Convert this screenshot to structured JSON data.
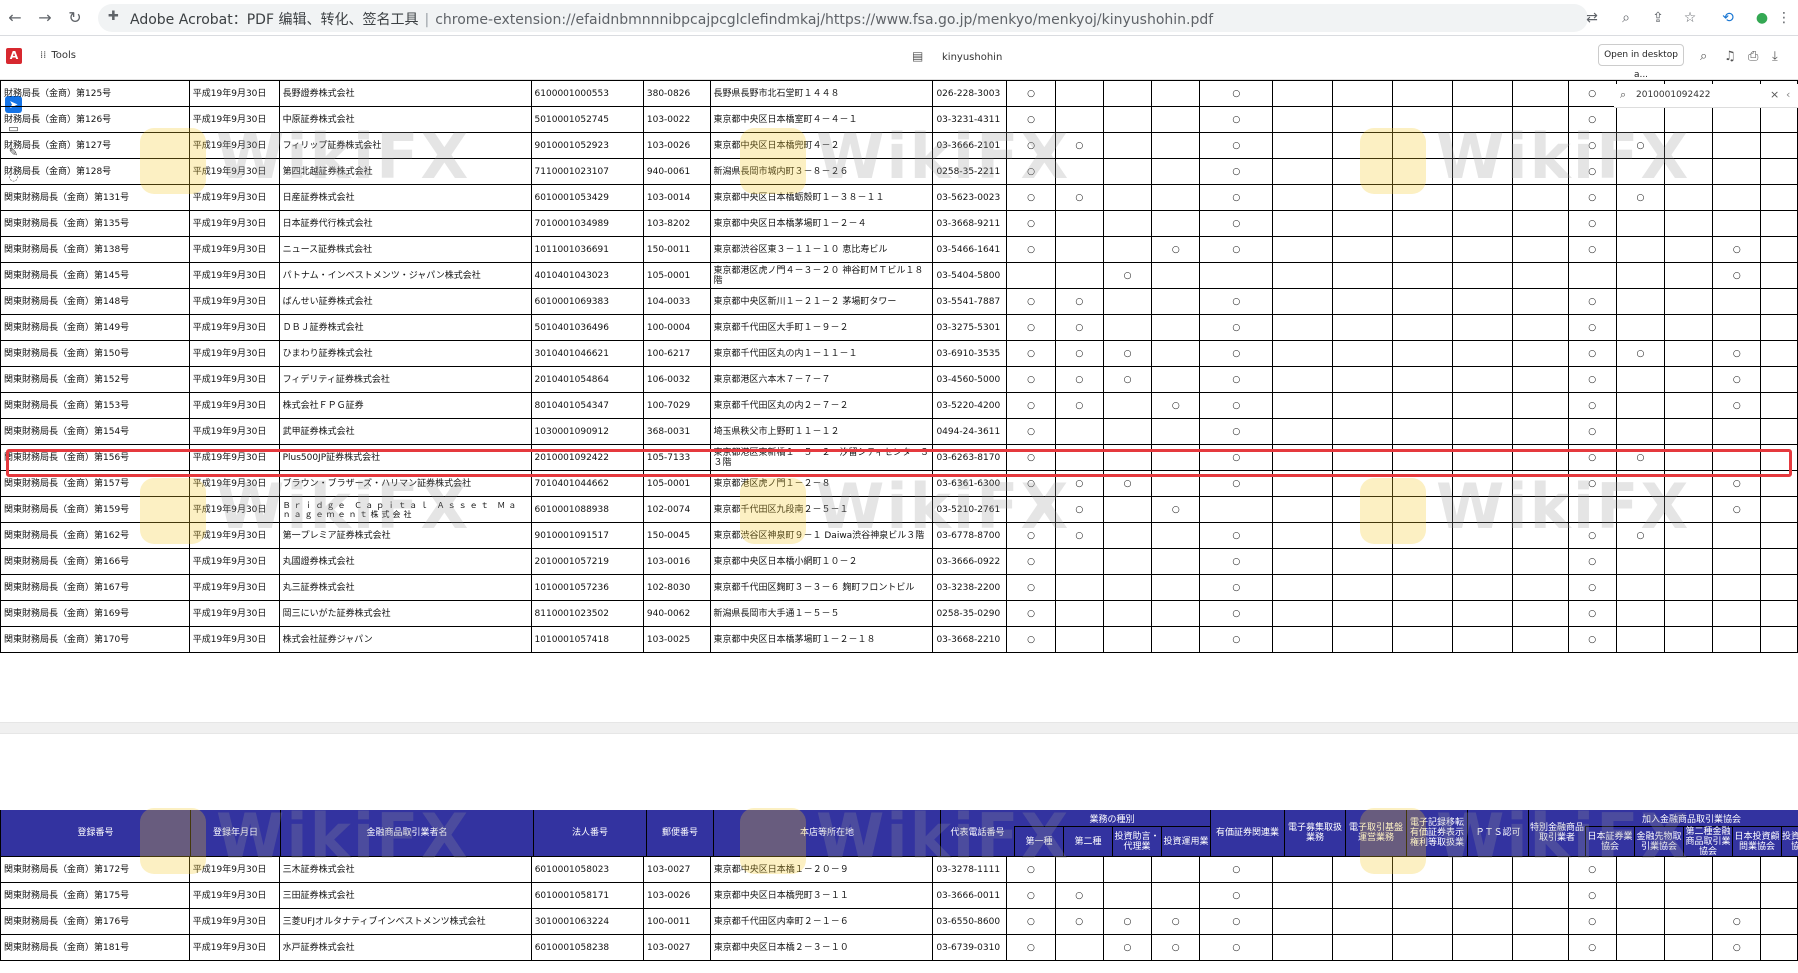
{
  "browser": {
    "tab_title": "Adobe Acrobat：PDF 编辑、转化、签名工具",
    "url": "chrome-extension://efaidnbmnnnibpcajpcglclefindmkaj/https://www.fsa.go.jp/menkyo/menkyoj/kinyushohin.pdf"
  },
  "acrobat": {
    "tools_label": "Tools",
    "doc_name": "kinyushohin",
    "open_desktop_label": "Open in desktop a...",
    "search_value": "2010001092422"
  },
  "watermark": {
    "text": "WikiFX"
  },
  "table_top": {
    "rows": [
      {
        "reg": "財務局長（金商）第125号",
        "date": "平成19年9月30日",
        "name": "長野證券株式会社",
        "corp": "6100001000553",
        "zip": "380-0826",
        "addr": "長野県長野市北石堂町１４４８",
        "tel": "026-228-3003",
        "m": [
          "○",
          "",
          "",
          "",
          "○",
          "",
          "",
          "",
          "",
          "",
          "○",
          "",
          "",
          "",
          ""
        ]
      },
      {
        "reg": "財務局長（金商）第126号",
        "date": "平成19年9月30日",
        "name": "中原証券株式会社",
        "corp": "5010001052745",
        "zip": "103-0022",
        "addr": "東京都中央区日本橋室町４－４－１",
        "tel": "03-3231-4311",
        "m": [
          "○",
          "",
          "",
          "",
          "○",
          "",
          "",
          "",
          "",
          "",
          "○",
          "",
          "",
          "",
          ""
        ]
      },
      {
        "reg": "財務局長（金商）第127号",
        "date": "平成19年9月30日",
        "name": "フィリップ証券株式会社",
        "corp": "9010001052923",
        "zip": "103-0026",
        "addr": "東京都中央区日本橋兜町４－２",
        "tel": "03-3666-2101",
        "m": [
          "○",
          "○",
          "",
          "",
          "○",
          "",
          "",
          "",
          "",
          "",
          "○",
          "○",
          "",
          "",
          ""
        ]
      },
      {
        "reg": "財務局長（金商）第128号",
        "date": "平成19年9月30日",
        "name": "第四北越証券株式会社",
        "corp": "7110001023107",
        "zip": "940-0061",
        "addr": "新潟県長岡市城内町３－８－２６",
        "tel": "0258-35-2211",
        "m": [
          "○",
          "",
          "",
          "",
          "○",
          "",
          "",
          "",
          "",
          "",
          "○",
          "",
          "",
          "",
          ""
        ]
      },
      {
        "reg": "関東財務局長（金商）第131号",
        "date": "平成19年9月30日",
        "name": "日産証券株式会社",
        "corp": "6010001053429",
        "zip": "103-0014",
        "addr": "東京都中央区日本橋蛎殻町１－３８－１１",
        "tel": "03-5623-0023",
        "m": [
          "○",
          "○",
          "",
          "",
          "○",
          "",
          "",
          "",
          "",
          "",
          "○",
          "○",
          "",
          "",
          ""
        ]
      },
      {
        "reg": "関東財務局長（金商）第135号",
        "date": "平成19年9月30日",
        "name": "日本証券代行株式会社",
        "corp": "7010001034989",
        "zip": "103-8202",
        "addr": "東京都中央区日本橋茅場町１－２－４",
        "tel": "03-3668-9211",
        "m": [
          "○",
          "",
          "",
          "",
          "○",
          "",
          "",
          "",
          "",
          "",
          "○",
          "",
          "",
          "",
          ""
        ]
      },
      {
        "reg": "関東財務局長（金商）第138号",
        "date": "平成19年9月30日",
        "name": "ニュース証券株式会社",
        "corp": "1011001036691",
        "zip": "150-0011",
        "addr": "東京都渋谷区東３－１１－１０ 恵比寿ビル",
        "tel": "03-5466-1641",
        "m": [
          "○",
          "",
          "",
          "○",
          "○",
          "",
          "",
          "",
          "",
          "",
          "○",
          "",
          "",
          "○",
          ""
        ]
      },
      {
        "reg": "関東財務局長（金商）第145号",
        "date": "平成19年9月30日",
        "name": "パトナム・インベストメンツ・ジャパン株式会社",
        "corp": "4010401043023",
        "zip": "105-0001",
        "addr": "東京都港区虎ノ門４－３－２０ 神谷町ＭＴビル１８階",
        "tel": "03-5404-5800",
        "m": [
          "",
          "",
          "○",
          "",
          "",
          "",
          "",
          "",
          "",
          "",
          "",
          "",
          "",
          "○",
          ""
        ]
      },
      {
        "reg": "関東財務局長（金商）第148号",
        "date": "平成19年9月30日",
        "name": "ばんせい証券株式会社",
        "corp": "6010001069383",
        "zip": "104-0033",
        "addr": "東京都中央区新川１－２１－２ 茅場町タワー",
        "tel": "03-5541-7887",
        "m": [
          "○",
          "○",
          "",
          "",
          "○",
          "",
          "",
          "",
          "",
          "",
          "○",
          "",
          "",
          "",
          ""
        ]
      },
      {
        "reg": "関東財務局長（金商）第149号",
        "date": "平成19年9月30日",
        "name": "ＤＢＪ証券株式会社",
        "corp": "5010401036496",
        "zip": "100-0004",
        "addr": "東京都千代田区大手町１－９－２",
        "tel": "03-3275-5301",
        "m": [
          "○",
          "○",
          "",
          "",
          "○",
          "",
          "",
          "",
          "",
          "",
          "○",
          "",
          "",
          "",
          ""
        ]
      },
      {
        "reg": "関東財務局長（金商）第150号",
        "date": "平成19年9月30日",
        "name": "ひまわり証券株式会社",
        "corp": "3010401046621",
        "zip": "100-6217",
        "addr": "東京都千代田区丸の内１－１１－１",
        "tel": "03-6910-3535",
        "m": [
          "○",
          "○",
          "○",
          "",
          "○",
          "",
          "",
          "",
          "",
          "",
          "○",
          "○",
          "",
          "○",
          ""
        ]
      },
      {
        "reg": "関東財務局長（金商）第152号",
        "date": "平成19年9月30日",
        "name": "フィデリティ証券株式会社",
        "corp": "2010401054864",
        "zip": "106-0032",
        "addr": "東京都港区六本木７－７－７",
        "tel": "03-4560-5000",
        "m": [
          "○",
          "○",
          "○",
          "",
          "○",
          "",
          "",
          "",
          "",
          "",
          "○",
          "",
          "",
          "○",
          ""
        ]
      },
      {
        "reg": "関東財務局長（金商）第153号",
        "date": "平成19年9月30日",
        "name": "株式会社ＦＰＧ証券",
        "corp": "8010401054347",
        "zip": "100-7029",
        "addr": "東京都千代田区丸の内２－７－２",
        "tel": "03-5220-4200",
        "m": [
          "○",
          "○",
          "",
          "○",
          "○",
          "",
          "",
          "",
          "",
          "",
          "○",
          "",
          "",
          "○",
          ""
        ]
      },
      {
        "reg": "関東財務局長（金商）第154号",
        "date": "平成19年9月30日",
        "name": "武甲証券株式会社",
        "corp": "1030001090912",
        "zip": "368-0031",
        "addr": "埼玉県秩父市上野町１１－１２",
        "tel": "0494-24-3611",
        "m": [
          "○",
          "",
          "",
          "",
          "○",
          "",
          "",
          "",
          "",
          "",
          "○",
          "",
          "",
          "",
          ""
        ]
      },
      {
        "reg": "関東財務局長（金商）第156号",
        "date": "平成19年9月30日",
        "name": "Plus500JP証券株式会社",
        "corp": "2010001092422",
        "zip": "105-7133",
        "addr": "東京都港区東新橋１－５－２　汐留シティセンター３３階",
        "tel": "03-6263-8170",
        "m": [
          "○",
          "",
          "",
          "",
          "○",
          "",
          "",
          "",
          "",
          "",
          "○",
          "○",
          "",
          "",
          ""
        ]
      },
      {
        "reg": "関東財務局長（金商）第157号",
        "date": "平成19年9月30日",
        "name": "ブラウン・ブラザーズ・ハリマン証券株式会社",
        "corp": "7010401044662",
        "zip": "105-0001",
        "addr": "東京都港区虎ノ門１－２－８",
        "tel": "03-6361-6300",
        "m": [
          "○",
          "○",
          "○",
          "",
          "○",
          "",
          "",
          "",
          "",
          "",
          "○",
          "",
          "",
          "○",
          ""
        ]
      },
      {
        "reg": "関東財務局長（金商）第159号",
        "date": "平成19年9月30日",
        "name": "Ｂｒｉｄｇｅ Ｃａｐｉｔａｌ Ａｓｓｅｔ Ｍａｎａｇｅｍｅｎｔ株式会社",
        "corp": "6010001088938",
        "zip": "102-0074",
        "addr": "東京都千代田区九段南２－５－１",
        "tel": "03-5210-2761",
        "m": [
          "",
          "○",
          "",
          "○",
          "",
          "",
          "",
          "",
          "",
          "",
          "",
          "",
          "",
          "○",
          ""
        ]
      },
      {
        "reg": "関東財務局長（金商）第162号",
        "date": "平成19年9月30日",
        "name": "第一プレミア証券株式会社",
        "corp": "9010001091517",
        "zip": "150-0045",
        "addr": "東京都渋谷区神泉町９－１ Daiwa渋谷神泉ビル３階",
        "tel": "03-6778-8700",
        "m": [
          "○",
          "○",
          "",
          "",
          "○",
          "",
          "",
          "",
          "",
          "",
          "○",
          "○",
          "",
          "",
          ""
        ]
      },
      {
        "reg": "関東財務局長（金商）第166号",
        "date": "平成19年9月30日",
        "name": "丸國證券株式会社",
        "corp": "2010001057219",
        "zip": "103-0016",
        "addr": "東京都中央区日本橋小網町１０－２",
        "tel": "03-3666-0922",
        "m": [
          "○",
          "",
          "",
          "",
          "○",
          "",
          "",
          "",
          "",
          "",
          "○",
          "",
          "",
          "",
          ""
        ]
      },
      {
        "reg": "関東財務局長（金商）第167号",
        "date": "平成19年9月30日",
        "name": "丸三証券株式会社",
        "corp": "1010001057236",
        "zip": "102-8030",
        "addr": "東京都千代田区麹町３－３－６ 麹町フロントビル",
        "tel": "03-3238-2200",
        "m": [
          "○",
          "",
          "",
          "",
          "○",
          "",
          "",
          "",
          "",
          "",
          "○",
          "",
          "",
          "",
          ""
        ]
      },
      {
        "reg": "関東財務局長（金商）第169号",
        "date": "平成19年9月30日",
        "name": "岡三にいがた証券株式会社",
        "corp": "8110001023502",
        "zip": "940-0062",
        "addr": "新潟県長岡市大手通１－５－５",
        "tel": "0258-35-0290",
        "m": [
          "○",
          "",
          "",
          "",
          "○",
          "",
          "",
          "",
          "",
          "",
          "○",
          "",
          "",
          "",
          ""
        ]
      },
      {
        "reg": "関東財務局長（金商）第170号",
        "date": "平成19年9月30日",
        "name": "株式会社証券ジャパン",
        "corp": "1010001057418",
        "zip": "103-0025",
        "addr": "東京都中央区日本橋茅場町１－２－１８",
        "tel": "03-3668-2210",
        "m": [
          "○",
          "",
          "",
          "",
          "○",
          "",
          "",
          "",
          "",
          "",
          "○",
          "",
          "",
          "",
          ""
        ]
      }
    ]
  },
  "table_header": {
    "reg": "登録番号",
    "date": "登録年月日",
    "name": "金融商品取引業者名",
    "corp": "法人番号",
    "zip": "郵便番号",
    "addr": "本店等所在地",
    "tel": "代表電話番号",
    "group_business": "業務の種別",
    "col_1": "第一種",
    "col_2": "第二種",
    "col_3": "投資助言・代理業",
    "col_4": "投資運用業",
    "col_5": "有価証券関連業",
    "col_6": "電子募集取扱業務",
    "col_7": "電子取引基盤運営業務",
    "col_8": "電子記録移転有価証券表示権利等取扱業",
    "col_9": "ＰＴＳ認可",
    "col_10": "特別金融商品取引業者",
    "group_assoc": "加入金融商品取引業協会",
    "col_11": "日本証券業協会",
    "col_12": "金融先物取引業協会",
    "col_13": "第二種金融商品取引業協会",
    "col_14": "日本投資顧問業協会",
    "col_15": "投資信託協会"
  },
  "table_bottom": {
    "rows": [
      {
        "reg": "関東財務局長（金商）第172号",
        "date": "平成19年9月30日",
        "name": "三木証券株式会社",
        "corp": "6010001058023",
        "zip": "103-0027",
        "addr": "東京都中央区日本橋１－２０－９",
        "tel": "03-3278-1111",
        "m": [
          "○",
          "",
          "",
          "",
          "○",
          "",
          "",
          "",
          "",
          "",
          "○",
          "",
          "",
          "",
          ""
        ]
      },
      {
        "reg": "関東財務局長（金商）第175号",
        "date": "平成19年9月30日",
        "name": "三田証券株式会社",
        "corp": "6010001058171",
        "zip": "103-0026",
        "addr": "東京都中央区日本橋兜町３－１１",
        "tel": "03-3666-0011",
        "m": [
          "○",
          "○",
          "",
          "",
          "○",
          "",
          "",
          "",
          "",
          "",
          "○",
          "",
          "",
          "",
          ""
        ]
      },
      {
        "reg": "関東財務局長（金商）第176号",
        "date": "平成19年9月30日",
        "name": "三菱UFJオルタナティブインベストメンツ株式会社",
        "corp": "3010001063224",
        "zip": "100-0011",
        "addr": "東京都千代田区内幸町２－１－６",
        "tel": "03-6550-8600",
        "m": [
          "○",
          "○",
          "○",
          "○",
          "○",
          "",
          "",
          "",
          "",
          "",
          "○",
          "",
          "",
          "○",
          ""
        ]
      },
      {
        "reg": "関東財務局長（金商）第181号",
        "date": "平成19年9月30日",
        "name": "水戸証券株式会社",
        "corp": "6010001058238",
        "zip": "103-0027",
        "addr": "東京都中央区日本橋２－３－１０",
        "tel": "03-6739-0310",
        "m": [
          "○",
          "",
          "○",
          "○",
          "○",
          "",
          "",
          "",
          "",
          "",
          "○",
          "",
          "",
          "○",
          ""
        ]
      }
    ]
  }
}
